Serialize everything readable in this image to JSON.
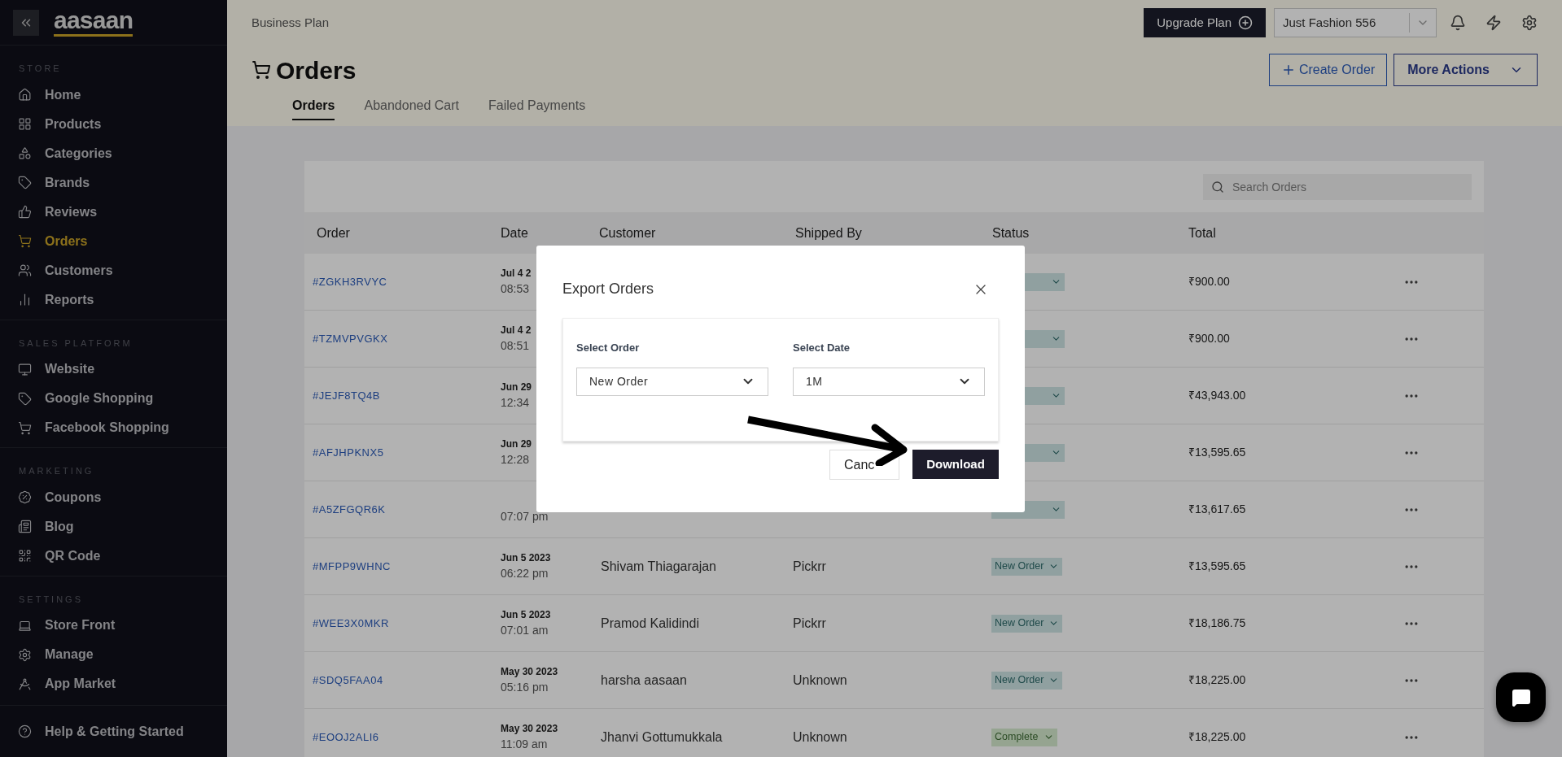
{
  "sidebar": {
    "logo": "aasaan",
    "sections": [
      {
        "title": "STORE",
        "items": [
          {
            "label": "Home",
            "selected": false
          },
          {
            "label": "Products",
            "selected": false
          },
          {
            "label": "Categories",
            "selected": false
          },
          {
            "label": "Brands",
            "selected": false
          },
          {
            "label": "Reviews",
            "selected": false
          },
          {
            "label": "Orders",
            "selected": true
          },
          {
            "label": "Customers",
            "selected": false
          },
          {
            "label": "Reports",
            "selected": false
          }
        ]
      },
      {
        "title": "SALES PLATFORM",
        "items": [
          {
            "label": "Website",
            "selected": false
          },
          {
            "label": "Google Shopping",
            "selected": false
          },
          {
            "label": "Facebook Shopping",
            "selected": false
          }
        ]
      },
      {
        "title": "MARKETING",
        "items": [
          {
            "label": "Coupons",
            "selected": false
          },
          {
            "label": "Blog",
            "selected": false
          },
          {
            "label": "QR Code",
            "selected": false
          }
        ]
      },
      {
        "title": "SETTINGS",
        "items": [
          {
            "label": "Store Front",
            "selected": false
          },
          {
            "label": "Manage",
            "selected": false
          },
          {
            "label": "App Market",
            "selected": false
          }
        ]
      }
    ],
    "help": "Help & Getting Started"
  },
  "header": {
    "plan": "Business Plan",
    "upgrade": "Upgrade Plan",
    "store": "Just Fashion 556",
    "title": "Orders",
    "create_order": "Create Order",
    "more_actions": "More Actions",
    "tabs": [
      {
        "label": "Orders",
        "selected": true
      },
      {
        "label": "Abandoned Cart",
        "selected": false
      },
      {
        "label": "Failed Payments",
        "selected": false
      }
    ]
  },
  "table": {
    "search": {
      "placeholder": "Search Orders"
    },
    "columns": [
      "Order",
      "Date",
      "Customer",
      "Shipped By",
      "Status",
      "Total"
    ],
    "rows": [
      {
        "order": "#ZGKH3RVYC",
        "date": "Jul 4 2",
        "time": "08:53",
        "status": {
          "kind": "new"
        },
        "total": "₹900.00"
      },
      {
        "order": "#TZMVPVGKX",
        "date": "Jul 4 2",
        "time": "08:51",
        "status": {
          "kind": "new"
        },
        "total": "₹900.00"
      },
      {
        "order": "#JEJF8TQ4B",
        "date": "Jun 29",
        "time": "12:34",
        "status": {
          "kind": "new"
        },
        "total": "₹43,943.00"
      },
      {
        "order": "#AFJHPKNX5",
        "date": "Jun 29",
        "time": "12:28",
        "status": {
          "kind": "new"
        },
        "total": "₹13,595.65"
      },
      {
        "order": "#A5ZFGQR6K",
        "time": "07:07 pm",
        "status": {
          "kind": "new"
        },
        "total": "₹13,617.65"
      },
      {
        "order": "#MFPP9WHNC",
        "date": "Jun 5 2023",
        "time": "06:22 pm",
        "customer": "Shivam Thiagarajan",
        "shipped_by": "Pickrr",
        "status": {
          "kind": "new",
          "label": "New Order"
        },
        "total": "₹13,595.65"
      },
      {
        "order": "#WEE3X0MKR",
        "date": "Jun 5 2023",
        "time": "07:01 am",
        "customer": "Pramod Kalidindi",
        "shipped_by": "Pickrr",
        "status": {
          "kind": "new",
          "label": "New Order"
        },
        "total": "₹18,186.75"
      },
      {
        "order": "#SDQ5FAA04",
        "date": "May 30 2023",
        "time": "05:16 pm",
        "customer": "harsha aasaan",
        "shipped_by": "Unknown",
        "status": {
          "kind": "new",
          "label": "New Order"
        },
        "total": "₹18,225.00"
      },
      {
        "order": "#EOOJ2ALI6",
        "date": "May 30 2023",
        "time": "11:09 am",
        "customer": "Jhanvi Gottumukkala",
        "shipped_by": "Unknown",
        "status": {
          "kind": "complete",
          "label": "Complete"
        },
        "total": "₹18,225.00"
      }
    ]
  },
  "modal": {
    "title": "Export Orders",
    "fields": [
      {
        "label": "Select Order",
        "value": "New Order"
      },
      {
        "label": "Select Date",
        "value": "1M"
      }
    ],
    "cancel": "Canc",
    "download": "Download"
  }
}
